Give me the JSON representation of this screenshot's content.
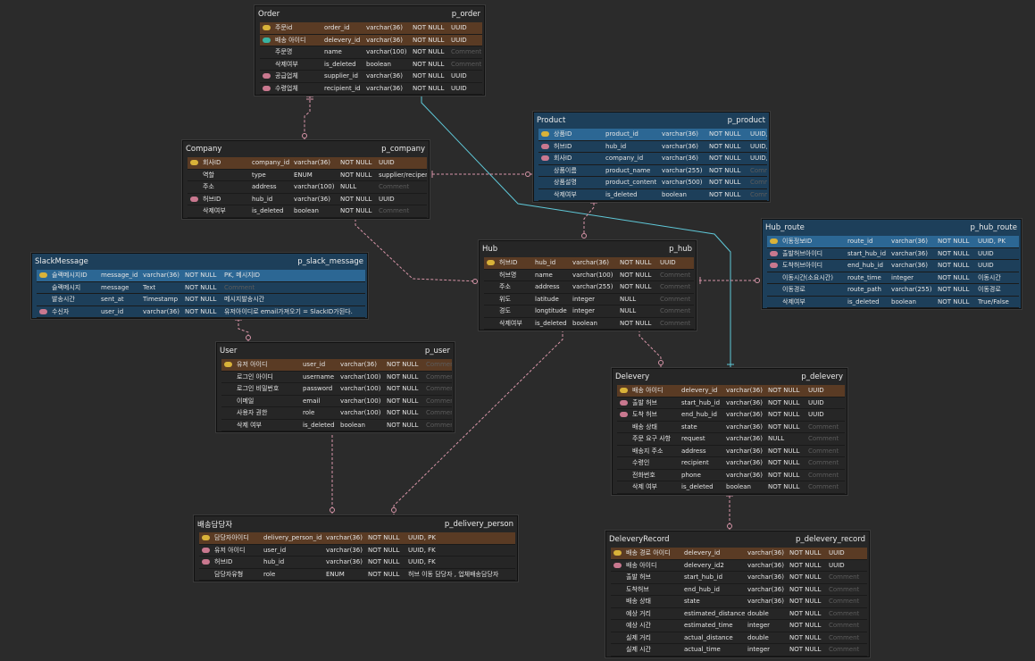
{
  "placeholders": {
    "comment": "Comment"
  },
  "tables": [
    {
      "id": "order",
      "name": "Order",
      "physical": "p_order",
      "rows": [
        {
          "key": "pk",
          "hl": true,
          "logical": "주문id",
          "column": "order_id",
          "type": "varchar(36)",
          "nn": "NOT NULL",
          "note": "UUID"
        },
        {
          "key": "uk",
          "hl": true,
          "logical": "배송 아이디",
          "column": "delevery_id",
          "type": "varchar(36)",
          "nn": "NOT NULL",
          "note": "UUID"
        },
        {
          "key": "",
          "hl": false,
          "logical": "주문명",
          "column": "name",
          "type": "varchar(100)",
          "nn": "NOT NULL",
          "note": ""
        },
        {
          "key": "",
          "hl": false,
          "logical": "삭제여부",
          "column": "is_deleted",
          "type": "boolean",
          "nn": "NOT NULL",
          "note": ""
        },
        {
          "key": "fk",
          "hl": false,
          "logical": "공급업체",
          "column": "supplier_id",
          "type": "varchar(36)",
          "nn": "NOT NULL",
          "note": "UUID"
        },
        {
          "key": "fk",
          "hl": false,
          "logical": "수령업체",
          "column": "recipient_id",
          "type": "varchar(36)",
          "nn": "NOT NULL",
          "note": "UUID"
        }
      ]
    },
    {
      "id": "company",
      "name": "Company",
      "physical": "p_company",
      "rows": [
        {
          "key": "pk",
          "hl": true,
          "logical": "회사ID",
          "column": "company_id",
          "type": "varchar(36)",
          "nn": "NOT NULL",
          "note": "UUID"
        },
        {
          "key": "",
          "hl": false,
          "logical": "역할",
          "column": "type",
          "type": "ENUM",
          "nn": "NOT NULL",
          "note": "supplier/recipent"
        },
        {
          "key": "",
          "hl": false,
          "logical": "주소",
          "column": "address",
          "type": "varchar(100)",
          "nn": "NULL",
          "note": ""
        },
        {
          "key": "fk",
          "hl": false,
          "logical": "허브ID",
          "column": "hub_id",
          "type": "varchar(36)",
          "nn": "NOT NULL",
          "note": "UUID"
        },
        {
          "key": "",
          "hl": false,
          "logical": "삭제여부",
          "column": "is_deleted",
          "type": "boolean",
          "nn": "NOT NULL",
          "note": ""
        }
      ]
    },
    {
      "id": "product",
      "name": "Product",
      "physical": "p_product",
      "rows": [
        {
          "key": "pk",
          "hl": true,
          "logical": "상품ID",
          "column": "product_id",
          "type": "varchar(36)",
          "nn": "NOT NULL",
          "note": "UUID, PK"
        },
        {
          "key": "fk",
          "hl": false,
          "logical": "허브ID",
          "column": "hub_id",
          "type": "varchar(36)",
          "nn": "NOT NULL",
          "note": "UUID, FK"
        },
        {
          "key": "fk",
          "hl": false,
          "logical": "회사ID",
          "column": "company_id",
          "type": "varchar(36)",
          "nn": "NOT NULL",
          "note": "UUID, FK"
        },
        {
          "key": "",
          "hl": false,
          "logical": "상품이름",
          "column": "product_name",
          "type": "varchar(255)",
          "nn": "NOT NULL",
          "note": ""
        },
        {
          "key": "",
          "hl": false,
          "logical": "상품설명",
          "column": "product_content",
          "type": "varchar(500)",
          "nn": "NOT NULL",
          "note": ""
        },
        {
          "key": "",
          "hl": false,
          "logical": "삭제여부",
          "column": "is_deleted",
          "type": "boolean",
          "nn": "NOT NULL",
          "note": ""
        }
      ]
    },
    {
      "id": "hub_route",
      "name": "Hub_route",
      "physical": "p_hub_route",
      "rows": [
        {
          "key": "pk",
          "hl": true,
          "logical": "이동정보ID",
          "column": "route_id",
          "type": "varchar(36)",
          "nn": "NOT NULL",
          "note": "UUID, PK"
        },
        {
          "key": "fk",
          "hl": false,
          "logical": "출발허브아이디",
          "column": "start_hub_id",
          "type": "varchar(36)",
          "nn": "NOT NULL",
          "note": "UUID"
        },
        {
          "key": "fk",
          "hl": false,
          "logical": "도착허브아이디",
          "column": "end_hub_id",
          "type": "varchar(36)",
          "nn": "NOT NULL",
          "note": "UUID"
        },
        {
          "key": "",
          "hl": false,
          "logical": "이동시간(소요시간)",
          "column": "route_time",
          "type": "integer",
          "nn": "NOT NULL",
          "note": "이동시간"
        },
        {
          "key": "",
          "hl": false,
          "logical": "이동경로",
          "column": "route_path",
          "type": "varchar(255)",
          "nn": "NOT NULL",
          "note": "이동경로"
        },
        {
          "key": "",
          "hl": false,
          "logical": "삭제여부",
          "column": "is_deleted",
          "type": "boolean",
          "nn": "NOT NULL",
          "note": "True/False"
        }
      ]
    },
    {
      "id": "hub",
      "name": "Hub",
      "physical": "p_hub",
      "rows": [
        {
          "key": "pk",
          "hl": true,
          "logical": "허브ID",
          "column": "hub_id",
          "type": "varchar(36)",
          "nn": "NOT NULL",
          "note": "UUID"
        },
        {
          "key": "",
          "hl": false,
          "logical": "허브명",
          "column": "name",
          "type": "varchar(100)",
          "nn": "NOT NULL",
          "note": ""
        },
        {
          "key": "",
          "hl": false,
          "logical": "주소",
          "column": "address",
          "type": "varchar(255)",
          "nn": "NOT NULL",
          "note": ""
        },
        {
          "key": "",
          "hl": false,
          "logical": "위도",
          "column": "latitude",
          "type": "integer",
          "nn": "NULL",
          "note": ""
        },
        {
          "key": "",
          "hl": false,
          "logical": "경도",
          "column": "longtitude",
          "type": "integer",
          "nn": "NULL",
          "note": ""
        },
        {
          "key": "",
          "hl": false,
          "logical": "삭제여부",
          "column": "is_deleted",
          "type": "boolean",
          "nn": "NOT NULL",
          "note": ""
        }
      ]
    },
    {
      "id": "slack",
      "name": "SlackMessage",
      "physical": "p_slack_message",
      "rows": [
        {
          "key": "pk",
          "hl": true,
          "logical": "슬랙메시지ID",
          "column": "message_id",
          "type": "varchar(36)",
          "nn": "NOT NULL",
          "note": "PK, 메시지ID"
        },
        {
          "key": "",
          "hl": false,
          "logical": "슬랙메시지",
          "column": "message",
          "type": "Text",
          "nn": "NOT NULL",
          "note": ""
        },
        {
          "key": "",
          "hl": false,
          "logical": "발송시간",
          "column": "sent_at",
          "type": "Timestamp",
          "nn": "NOT NULL",
          "note": "메시지발송시간"
        },
        {
          "key": "fk",
          "hl": false,
          "logical": "수신자",
          "column": "user_id",
          "type": "varchar(36)",
          "nn": "NOT NULL",
          "note": "유저아이디로 email가져오기 = SlackID가된다."
        }
      ]
    },
    {
      "id": "user",
      "name": "User",
      "physical": "p_user",
      "rows": [
        {
          "key": "pk",
          "hl": true,
          "logical": "유저 아이디",
          "column": "user_id",
          "type": "varchar(36)",
          "nn": "NOT NULL",
          "note": ""
        },
        {
          "key": "",
          "hl": false,
          "logical": "로그인 아이디",
          "column": "username",
          "type": "varchar(100)",
          "nn": "NOT NULL",
          "note": ""
        },
        {
          "key": "",
          "hl": false,
          "logical": "로그인 비밀번호",
          "column": "password",
          "type": "varchar(100)",
          "nn": "NOT NULL",
          "note": ""
        },
        {
          "key": "",
          "hl": false,
          "logical": "이메일",
          "column": "email",
          "type": "varchar(100)",
          "nn": "NOT NULL",
          "note": ""
        },
        {
          "key": "",
          "hl": false,
          "logical": "사용자 권한",
          "column": "role",
          "type": "varchar(100)",
          "nn": "NOT NULL",
          "note": ""
        },
        {
          "key": "",
          "hl": false,
          "logical": "삭제 여부",
          "column": "is_deleted",
          "type": "boolean",
          "nn": "NOT NULL",
          "note": ""
        }
      ]
    },
    {
      "id": "delevery",
      "name": "Delevery",
      "physical": "p_delevery",
      "rows": [
        {
          "key": "pk",
          "hl": true,
          "logical": "배송 아이디",
          "column": "delevery_id",
          "type": "varchar(36)",
          "nn": "NOT NULL",
          "note": "UUID"
        },
        {
          "key": "fk",
          "hl": false,
          "logical": "출발 허브",
          "column": "start_hub_id",
          "type": "varchar(36)",
          "nn": "NOT NULL",
          "note": "UUID"
        },
        {
          "key": "fk",
          "hl": false,
          "logical": "도착 허브",
          "column": "end_hub_id",
          "type": "varchar(36)",
          "nn": "NOT NULL",
          "note": "UUID"
        },
        {
          "key": "",
          "hl": false,
          "logical": "배송 상태",
          "column": "state",
          "type": "varchar(36)",
          "nn": "NOT NULL",
          "note": ""
        },
        {
          "key": "",
          "hl": false,
          "logical": "주문 요구 사항",
          "column": "request",
          "type": "varchar(36)",
          "nn": "NULL",
          "note": ""
        },
        {
          "key": "",
          "hl": false,
          "logical": "배송지 주소",
          "column": "address",
          "type": "varchar(36)",
          "nn": "NOT NULL",
          "note": ""
        },
        {
          "key": "",
          "hl": false,
          "logical": "수령인",
          "column": "recipient",
          "type": "varchar(36)",
          "nn": "NOT NULL",
          "note": ""
        },
        {
          "key": "",
          "hl": false,
          "logical": "전화번호",
          "column": "phone",
          "type": "varchar(36)",
          "nn": "NOT NULL",
          "note": ""
        },
        {
          "key": "",
          "hl": false,
          "logical": "삭제 여부",
          "column": "is_deleted",
          "type": "boolean",
          "nn": "NOT NULL",
          "note": ""
        }
      ]
    },
    {
      "id": "delivery_person",
      "name": "배송담당자",
      "physical": "p_delivery_person",
      "rows": [
        {
          "key": "pk",
          "hl": true,
          "logical": "담당자아이디",
          "column": "delivery_person_id",
          "type": "varchar(36)",
          "nn": "NOT NULL",
          "note": "UUID, PK"
        },
        {
          "key": "fk",
          "hl": false,
          "logical": "유저 아이디",
          "column": "user_id",
          "type": "varchar(36)",
          "nn": "NOT NULL",
          "note": "UUID, FK"
        },
        {
          "key": "fk",
          "hl": false,
          "logical": "허브ID",
          "column": "hub_id",
          "type": "varchar(36)",
          "nn": "NOT NULL",
          "note": "UUID, FK"
        },
        {
          "key": "",
          "hl": false,
          "logical": "담당자유형",
          "column": "role",
          "type": "ENUM",
          "nn": "NOT NULL",
          "note": "허브 이동 담당자 , 업체배송담당자"
        }
      ]
    },
    {
      "id": "delevery_record",
      "name": "DeleveryRecord",
      "physical": "p_delevery_record",
      "rows": [
        {
          "key": "pk",
          "hl": true,
          "logical": "배송 경로 아이디",
          "column": "delevery_id",
          "type": "varchar(36)",
          "nn": "NOT NULL",
          "note": "UUID"
        },
        {
          "key": "fk",
          "hl": false,
          "logical": "배송 아이디",
          "column": "delevery_id2",
          "type": "varchar(36)",
          "nn": "NOT NULL",
          "note": "UUID"
        },
        {
          "key": "",
          "hl": false,
          "logical": "출발 허브",
          "column": "start_hub_id",
          "type": "varchar(36)",
          "nn": "NOT NULL",
          "note": ""
        },
        {
          "key": "",
          "hl": false,
          "logical": "도착허브",
          "column": "end_hub_id",
          "type": "varchar(36)",
          "nn": "NOT NULL",
          "note": ""
        },
        {
          "key": "",
          "hl": false,
          "logical": "배송 상태",
          "column": "state",
          "type": "varchar(36)",
          "nn": "NOT NULL",
          "note": ""
        },
        {
          "key": "",
          "hl": false,
          "logical": "예상 거리",
          "column": "estimated_distance",
          "type": "double",
          "nn": "NOT NULL",
          "note": ""
        },
        {
          "key": "",
          "hl": false,
          "logical": "예상 시간",
          "column": "estimated_time",
          "type": "integer",
          "nn": "NOT NULL",
          "note": ""
        },
        {
          "key": "",
          "hl": false,
          "logical": "실제 거리",
          "column": "actual_distance",
          "type": "double",
          "nn": "NOT NULL",
          "note": ""
        },
        {
          "key": "",
          "hl": false,
          "logical": "실제 시간",
          "column": "actual_time",
          "type": "integer",
          "nn": "NOT NULL",
          "note": ""
        }
      ]
    }
  ]
}
